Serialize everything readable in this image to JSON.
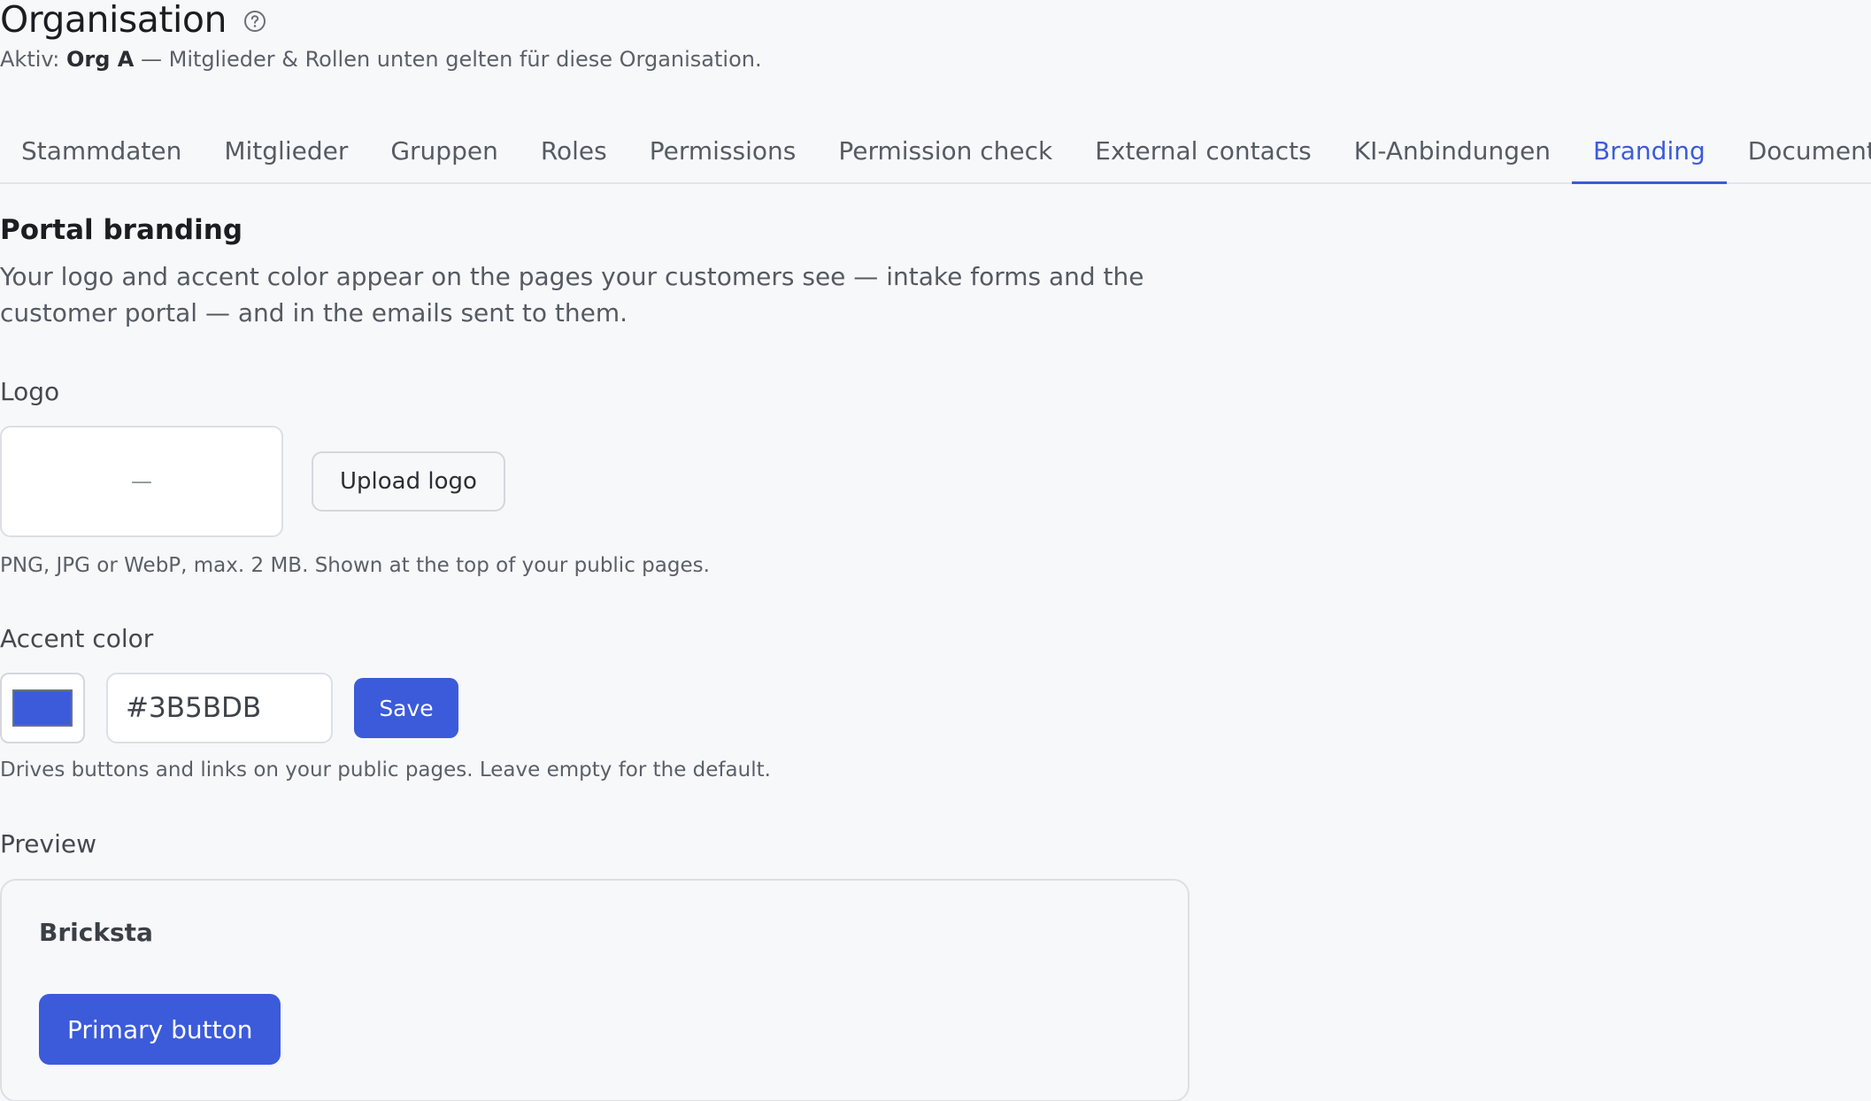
{
  "header": {
    "title": "Organisation",
    "help_icon": "question-circle-icon",
    "subtitle_prefix": "Aktiv: ",
    "active_org": "Org A",
    "subtitle_suffix": " — Mitglieder & Rollen unten gelten für diese Organisation."
  },
  "tabs": [
    {
      "label": "Stammdaten",
      "active": false
    },
    {
      "label": "Mitglieder",
      "active": false
    },
    {
      "label": "Gruppen",
      "active": false
    },
    {
      "label": "Roles",
      "active": false
    },
    {
      "label": "Permissions",
      "active": false
    },
    {
      "label": "Permission check",
      "active": false
    },
    {
      "label": "External contacts",
      "active": false
    },
    {
      "label": "KI-Anbindungen",
      "active": false
    },
    {
      "label": "Branding",
      "active": true
    },
    {
      "label": "Documents",
      "active": false
    }
  ],
  "section": {
    "title": "Portal branding",
    "description": "Your logo and accent color appear on the pages your customers see — intake forms and the customer portal — and in the emails sent to them."
  },
  "logo": {
    "label": "Logo",
    "placeholder": "—",
    "upload_label": "Upload logo",
    "hint": "PNG, JPG or WebP, max. 2 MB. Shown at the top of your public pages."
  },
  "accent": {
    "label": "Accent color",
    "value": "#3B5BDB",
    "swatch_color": "#3b5bdb",
    "save_label": "Save",
    "hint": "Drives buttons and links on your public pages. Leave empty for the default."
  },
  "preview": {
    "label": "Preview",
    "brand_name": "Bricksta",
    "button_label": "Primary button"
  },
  "colors": {
    "accent": "#3b5bdb",
    "background": "#f7f8fa"
  }
}
